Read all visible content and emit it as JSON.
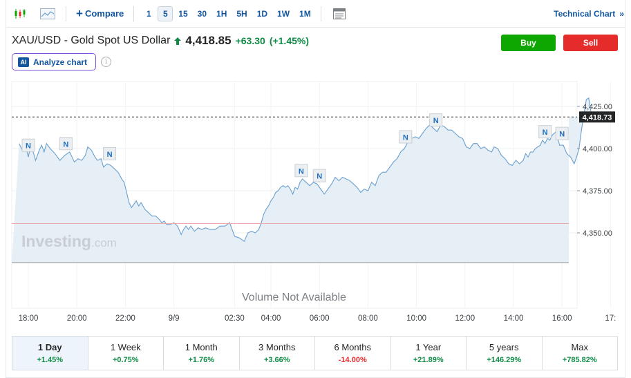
{
  "toolbar": {
    "compare_label": "Compare",
    "intervals": [
      "1",
      "5",
      "15",
      "30",
      "1H",
      "5H",
      "1D",
      "1W",
      "1M"
    ],
    "active_interval": "5",
    "technical_chart_label": "Technical Chart",
    "technical_chart_chevron": "»"
  },
  "header": {
    "instrument": "XAU/USD - Gold Spot US Dollar",
    "price": "4,418.85",
    "change": "+63.30",
    "change_pct": "(+1.45%)",
    "buy_label": "Buy",
    "sell_label": "Sell",
    "analyze_label": "Analyze chart",
    "ai_badge": "AI",
    "info_glyph": "i"
  },
  "colors": {
    "positive": "#0e8c45",
    "negative": "#e62b2b",
    "buy": "#0ea600",
    "sell": "#e62b2b",
    "link": "#1256a0",
    "line": "#6a9fcf",
    "area": "#e6eef6"
  },
  "chart": {
    "watermark_main": "Investing",
    "watermark_suffix": ".com",
    "volume_message": "Volume Not Available",
    "news_marker_label": "N"
  },
  "chart_data": {
    "type": "area",
    "grid": true,
    "legend": "none",
    "y_range": [
      4335,
      4432
    ],
    "y_ticks": [
      {
        "value": 4425,
        "label": "4,425.00"
      },
      {
        "value": 4400,
        "label": "4,400.00"
      },
      {
        "value": 4375,
        "label": "4,375.00"
      },
      {
        "value": 4350,
        "label": "4,350.00"
      }
    ],
    "current_value": 4418.73,
    "current_label": "4,418.73",
    "reference_value": 4355.55,
    "x_range": [
      17.6,
      42.3
    ],
    "x_ticks": [
      {
        "h": 18,
        "label": "18:00"
      },
      {
        "h": 20,
        "label": "20:00"
      },
      {
        "h": 22,
        "label": "22:00"
      },
      {
        "h": 24,
        "label": "9/9"
      },
      {
        "h": 26.5,
        "label": "02:30"
      },
      {
        "h": 28,
        "label": "04:00"
      },
      {
        "h": 30,
        "label": "06:00"
      },
      {
        "h": 32,
        "label": "08:00"
      },
      {
        "h": 34,
        "label": "10:00"
      },
      {
        "h": 36,
        "label": "12:00"
      },
      {
        "h": 38,
        "label": "14:00"
      },
      {
        "h": 40,
        "label": "16:00"
      },
      {
        "h": 42,
        "label": "17:"
      }
    ],
    "series": [
      {
        "x": [
          17.62,
          17.75,
          17.88,
          18.0,
          18.1,
          18.2,
          18.3,
          18.45,
          18.55,
          18.65,
          18.75,
          18.9,
          19.1,
          19.3,
          19.5,
          19.7,
          19.9,
          20.05,
          20.2,
          20.35,
          20.45,
          20.6,
          20.75,
          20.85,
          21.0,
          21.1,
          21.25,
          21.4,
          21.55,
          21.7,
          21.85,
          21.95,
          22.05,
          22.15,
          22.25,
          22.35,
          22.45,
          22.55,
          22.65,
          22.8,
          22.95,
          23.1,
          23.25,
          23.4,
          23.5,
          23.6,
          23.7,
          23.85,
          24.0,
          24.15,
          24.3,
          24.4,
          24.5,
          24.6,
          24.7,
          24.85,
          25.0,
          25.15,
          25.3,
          25.5,
          25.7,
          25.9,
          26.1,
          26.3,
          26.5,
          26.7,
          26.9,
          27.05,
          27.2,
          27.35,
          27.5,
          27.6,
          27.7,
          27.8,
          27.9,
          28.0,
          28.1,
          28.2,
          28.3,
          28.4,
          28.5,
          28.6,
          28.7,
          28.8,
          28.9,
          29.0,
          29.1,
          29.2,
          29.3,
          29.45,
          29.6,
          29.75,
          29.9,
          30.0,
          30.1,
          30.2,
          30.35,
          30.5,
          30.65,
          30.8,
          30.95,
          31.1,
          31.25,
          31.4,
          31.55,
          31.7,
          31.85,
          32.0,
          32.15,
          32.3,
          32.45,
          32.6,
          32.75,
          32.9,
          33.05,
          33.2,
          33.35,
          33.5,
          33.65,
          33.8,
          33.95,
          34.1,
          34.25,
          34.4,
          34.55,
          34.7,
          34.85,
          35.0,
          35.15,
          35.3,
          35.45,
          35.6,
          35.75,
          35.9,
          36.05,
          36.2,
          36.35,
          36.5,
          36.65,
          36.8,
          36.95,
          37.1,
          37.2,
          37.35,
          37.5,
          37.65,
          37.8,
          37.95,
          38.1,
          38.25,
          38.4,
          38.5,
          38.6,
          38.7,
          38.8,
          38.9,
          39.0,
          39.1,
          39.2,
          39.3,
          39.4,
          39.5,
          39.6,
          39.75,
          39.9,
          40.05,
          40.2,
          40.35,
          40.5,
          40.6,
          40.7,
          40.8,
          40.9,
          41.0,
          41.1,
          41.2,
          41.3
        ],
        "values": [
          4403,
          4399,
          4402,
          4395,
          4402,
          4398,
          4393,
          4399,
          4402,
          4398,
          4403,
          4400,
          4397,
          4393,
          4396,
          4398,
          4392,
          4394,
          4393,
          4396,
          4401,
          4399,
          4395,
          4393,
          4394,
          4389,
          4391,
          4390,
          4388,
          4386,
          4382,
          4380,
          4374,
          4368,
          4365,
          4367,
          4369,
          4366,
          4368,
          4364,
          4362,
          4360,
          4360,
          4358,
          4356,
          4357,
          4355,
          4355,
          4356,
          4354,
          4349,
          4352,
          4354,
          4352,
          4354,
          4351,
          4353,
          4352,
          4353,
          4352,
          4352,
          4354,
          4354,
          4356,
          4348,
          4347,
          4345,
          4350,
          4351,
          4350,
          4352,
          4356,
          4361,
          4364,
          4366,
          4369,
          4371,
          4374,
          4375,
          4377,
          4378,
          4377,
          4378,
          4376,
          4373,
          4377,
          4376,
          4380,
          4382,
          4380,
          4378,
          4380,
          4379,
          4377,
          4375,
          4373,
          4376,
          4379,
          4383,
          4381,
          4383,
          4382,
          4381,
          4379,
          4377,
          4374,
          4376,
          4375,
          4380,
          4378,
          4384,
          4386,
          4386,
          4389,
          4392,
          4394,
          4398,
          4400,
          4404,
          4406,
          4407,
          4406,
          4409,
          4412,
          4414,
          4412,
          4410,
          4414,
          4413,
          4411,
          4411,
          4409,
          4407,
          4406,
          4401,
          4400,
          4403,
          4403,
          4400,
          4401,
          4399,
          4398,
          4401,
          4400,
          4396,
          4394,
          4391,
          4390,
          4393,
          4391,
          4393,
          4397,
          4395,
          4398,
          4398,
          4400,
          4401,
          4402,
          4405,
          4403,
          4406,
          4405,
          4408,
          4410,
          4402,
          4402,
          4397,
          4395,
          4391,
          4395,
          4400,
          4411,
          4420,
          4429,
          4430,
          4421,
          4418.73
        ]
      }
    ],
    "news_markers_at": [
      18.0,
      19.55,
      21.35,
      29.25,
      30.0,
      33.55,
      34.8,
      39.3,
      40.0
    ]
  },
  "periods": [
    {
      "label": "1 Day",
      "value": "+1.45%",
      "sign": "pos",
      "active": true
    },
    {
      "label": "1 Week",
      "value": "+0.75%",
      "sign": "pos",
      "active": false
    },
    {
      "label": "1 Month",
      "value": "+1.76%",
      "sign": "pos",
      "active": false
    },
    {
      "label": "3 Months",
      "value": "+3.66%",
      "sign": "pos",
      "active": false
    },
    {
      "label": "6 Months",
      "value": "-14.00%",
      "sign": "neg",
      "active": false
    },
    {
      "label": "1 Year",
      "value": "+21.89%",
      "sign": "pos",
      "active": false
    },
    {
      "label": "5 years",
      "value": "+146.29%",
      "sign": "pos",
      "active": false
    },
    {
      "label": "Max",
      "value": "+785.82%",
      "sign": "pos",
      "active": false
    }
  ]
}
